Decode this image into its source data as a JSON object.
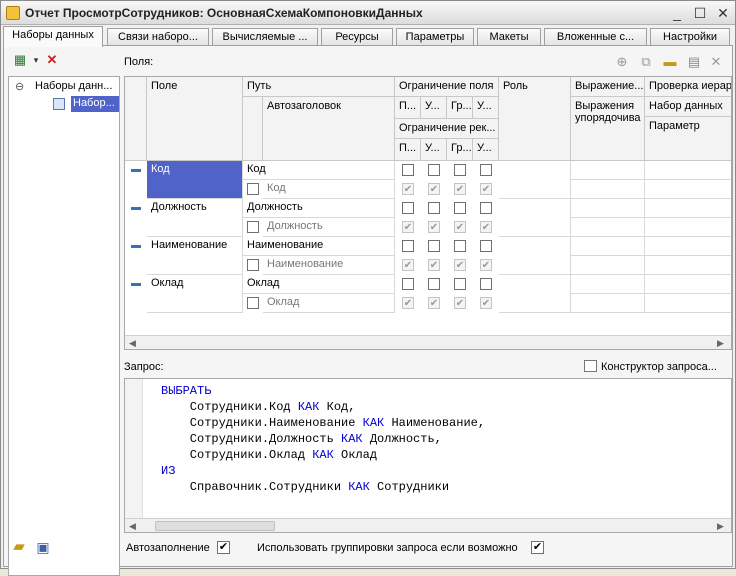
{
  "window": {
    "title": "Отчет ПросмотрСотрудников: ОсновнаяСхемаКомпоновкиДанных",
    "minimize": "_",
    "maximize": "☐",
    "close": "✕"
  },
  "tabs": [
    {
      "label": "Наборы данных",
      "active": true
    },
    {
      "label": "Связи наборо..."
    },
    {
      "label": "Вычисляемые ..."
    },
    {
      "label": "Ресурсы"
    },
    {
      "label": "Параметры"
    },
    {
      "label": "Макеты"
    },
    {
      "label": "Вложенные с..."
    },
    {
      "label": "Настройки"
    }
  ],
  "tree": {
    "root_label": "Наборы данн...",
    "root_toggle": "⊖",
    "child_label": "Набор..."
  },
  "fields_section": {
    "label": "Поля:",
    "columns": {
      "field": "Поле",
      "path": "Путь",
      "autotitle": "Автозаголовок",
      "field_restriction": "Ограничение поля",
      "req_restriction": "Ограничение рек...",
      "sub": [
        "П...",
        "У...",
        "Гр...",
        "У..."
      ],
      "role": "Роль",
      "expression": "Выражение...",
      "order_expression": "Выражения упорядочива",
      "hierarchy_check": "Проверка иерар",
      "dataset": "Набор данных",
      "parameter": "Параметр"
    },
    "rows": [
      {
        "field": "Код",
        "path": "Код",
        "title": "Код",
        "selected": true
      },
      {
        "field": "Должность",
        "path": "Должность",
        "title": "Должность"
      },
      {
        "field": "Наименование",
        "path": "Наименование",
        "title": "Наименование"
      },
      {
        "field": "Оклад",
        "path": "Оклад",
        "title": "Оклад"
      }
    ]
  },
  "query": {
    "label": "Запрос:",
    "builder_label": "Конструктор запроса..."
  },
  "bottom": {
    "autofill_label": "Автозаполнение",
    "autofill_checked": true,
    "use_groupings_label": "Использовать группировки запроса если возможно",
    "use_groupings_checked": true
  },
  "colors": {
    "selected_cell": "#4f63c8",
    "keyword": "#0000cc"
  }
}
